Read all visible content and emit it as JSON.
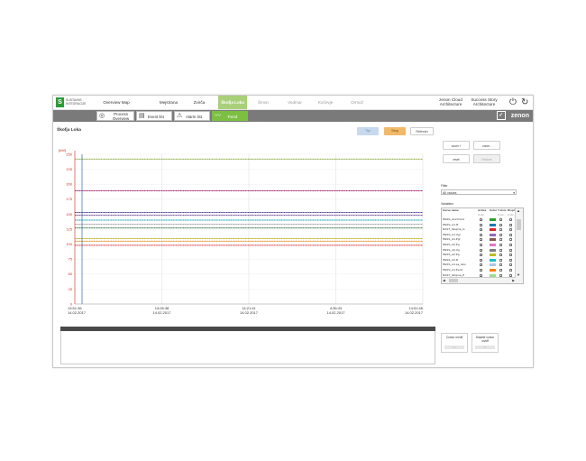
{
  "brand": {
    "logo_mark": "S",
    "logo_text": "SUSTAVNE INTEGRACIJE"
  },
  "topnav": {
    "items": [
      "Overview Map",
      "Mejstrana",
      "Zvirča",
      "Škofja Loka",
      "Šmon",
      "Vodmar",
      "Kočevje",
      "Ormož"
    ],
    "active": "Škofja Loka",
    "right_items": [
      "zenon Cloud Architecture",
      "Success Story Architecture"
    ],
    "power_icon": "power-icon",
    "refresh_icon": "refresh-icon"
  },
  "subnav": {
    "items": [
      {
        "label": "Process Overview",
        "icon": "process-icon"
      },
      {
        "label": "Event list",
        "icon": "event-list-icon"
      },
      {
        "label": "Alarm list",
        "icon": "alarm-icon"
      },
      {
        "label": "Trend",
        "icon": "trend-icon"
      }
    ],
    "brand": "zenon"
  },
  "page": {
    "title": "Škofja Loka"
  },
  "toolbar": {
    "btn1": "Tipi",
    "btn2": "Stop",
    "refresh": "Refresh"
  },
  "right_panel": {
    "zoom_in": "zoom +",
    "zoom_out": "zoom -",
    "reset": "reset",
    "restore": "Restore",
    "filter_label": "Filter",
    "filter_value": "All values",
    "variables_label": "Variables",
    "table_headers": [
      "Curve name",
      "Active",
      "Color",
      "Y-Axis",
      "Displ."
    ],
    "table_subheaders": [
      "X-Ax.",
      "X-Ax.",
      "X-Ax."
    ],
    "rows": [
      {
        "name": "HESS_AL2.Pend",
        "color": "#2ca02c"
      },
      {
        "name": "HESS_A1.Ift",
        "color": "#1f77b4"
      },
      {
        "name": "RAST_Skupna_G",
        "color": "#d62728"
      },
      {
        "name": "HESS_A1.Ugi",
        "color": "#9467bd"
      },
      {
        "name": "HESS_A1.Pgl",
        "color": "#8c564b"
      },
      {
        "name": "HESS_A2.Pg",
        "color": "#e377c2"
      },
      {
        "name": "HESS_A2.Ug",
        "color": "#7f7f7f"
      },
      {
        "name": "HESS_A2.Pg",
        "color": "#bcbd22"
      },
      {
        "name": "HESS_A2.R",
        "color": "#17becf"
      },
      {
        "name": "HESS_A1.sa_razu",
        "color": "#aec7e8"
      },
      {
        "name": "HESS_A1.Pend",
        "color": "#ff7f0e"
      },
      {
        "name": "RAST_Skupna_P",
        "color": "#98df8a"
      }
    ]
  },
  "bottom_buttons": {
    "cursor_on": "Cursor on/off",
    "cursor_off": "Disable cursor on/off",
    "left_glyph": "<<",
    "right_glyph": ">>"
  },
  "chart_data": {
    "type": "line",
    "ylabel": "[kW]",
    "y_ticks": [
      0,
      25,
      50,
      75,
      100,
      125,
      150,
      175,
      200,
      225,
      250
    ],
    "ylim": [
      0,
      250
    ],
    "x_ticks": [
      {
        "time": "13:51:36",
        "date": "14.02.2017"
      },
      {
        "time": "14:06:38",
        "date": "14.02.2017"
      },
      {
        "time": "14:21:41",
        "date": "14.02.2017"
      },
      {
        "time": "4:36:43",
        "date": "14.02.2017"
      },
      {
        "time": "14:51:46",
        "date": "14.02.2017"
      }
    ],
    "grid": true,
    "series": [
      {
        "color": "#7e9d2a",
        "values": [
          242,
          242,
          242,
          242,
          242
        ]
      },
      {
        "color": "#a0236a",
        "values": [
          189,
          189,
          189,
          189,
          189
        ]
      },
      {
        "color": "#3a2a8f",
        "values": [
          153,
          153,
          153,
          153,
          153
        ]
      },
      {
        "color": "#5b2e8a",
        "values": [
          148,
          148,
          148,
          148,
          148
        ]
      },
      {
        "color": "#1aa3b0",
        "values": [
          140,
          140,
          140,
          140,
          140
        ]
      },
      {
        "color": "#8a8a8a",
        "values": [
          133,
          133,
          133,
          133,
          133
        ]
      },
      {
        "color": "#2a6a3a",
        "values": [
          127,
          127,
          127,
          127,
          127
        ]
      },
      {
        "color": "#b6a600",
        "values": [
          109,
          109,
          109,
          109,
          109
        ]
      },
      {
        "color": "#e07b00",
        "values": [
          105,
          105,
          105,
          105,
          105
        ]
      },
      {
        "color": "#d81c1c",
        "values": [
          98,
          98,
          98,
          98,
          98
        ]
      }
    ]
  }
}
